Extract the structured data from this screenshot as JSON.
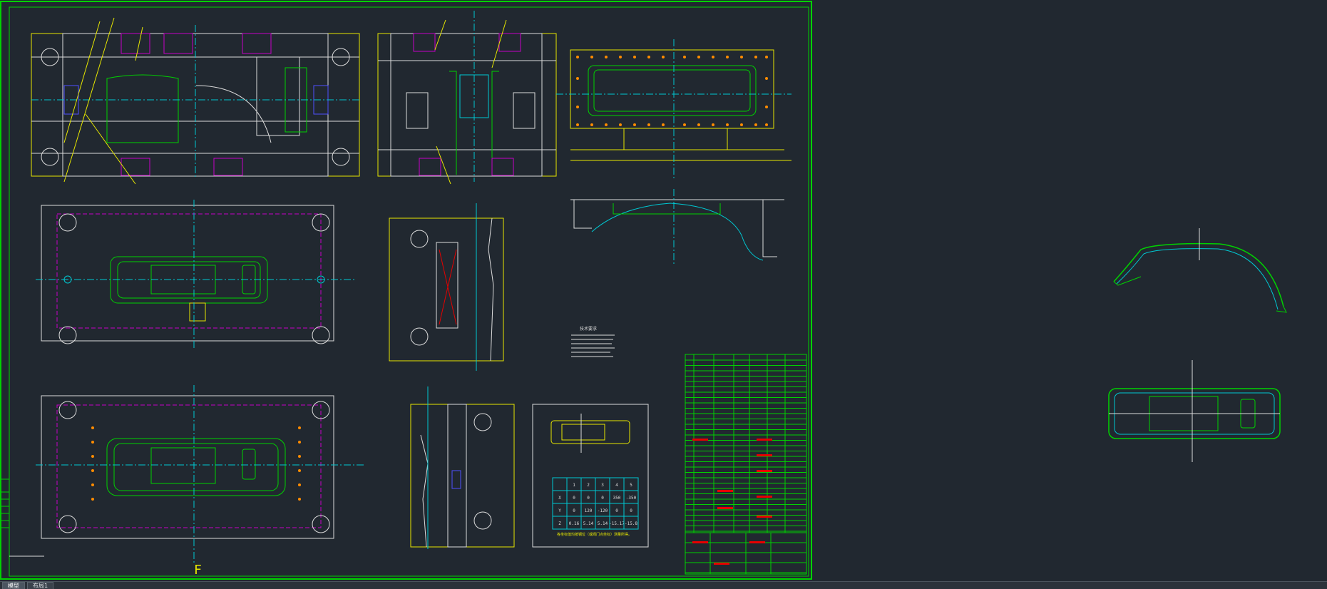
{
  "tabs": [
    {
      "label": "模型",
      "active": true
    },
    {
      "label": "布局1",
      "active": false
    }
  ],
  "colors": {
    "background": "#212830",
    "frame": "#00d200",
    "yellow": "#e6e600",
    "cyan": "#00c8d2",
    "magenta": "#c800c8",
    "white": "#dcdcdc",
    "red": "#e60000"
  },
  "drawing": {
    "section_mark": "F",
    "tech_requirements_heading": "技术要求",
    "coord_note": "各坐标值均按钢位（或阀门点坐标）测量所得。",
    "coord_table": {
      "header": [
        "",
        "1",
        "2",
        "3",
        "4",
        "5"
      ],
      "rows": [
        [
          "X",
          "0",
          "0",
          "0",
          "350",
          "-350"
        ],
        [
          "Y",
          "0",
          "120",
          "-120",
          "0",
          "0"
        ],
        [
          "Z",
          "0.16",
          "5.14",
          "5.14",
          "-15.17",
          "-15.8"
        ]
      ]
    }
  }
}
